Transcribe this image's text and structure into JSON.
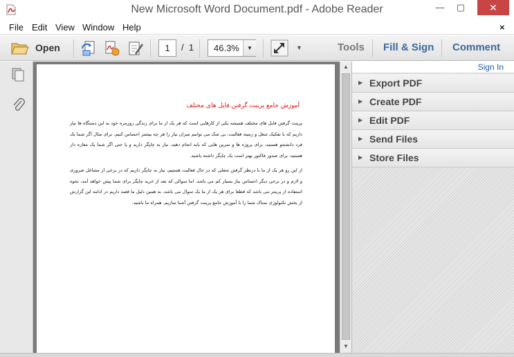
{
  "window": {
    "title": "New Microsoft Word Document.pdf - Adobe Reader",
    "minimize_glyph": "—",
    "maximize_glyph": "▢",
    "close_glyph": "✕"
  },
  "menu": {
    "items": [
      "File",
      "Edit",
      "View",
      "Window",
      "Help"
    ],
    "close_glyph": "×"
  },
  "toolbar": {
    "open_label": "Open",
    "page_current": "1",
    "page_separator": "/",
    "page_total": "1",
    "zoom": "46.3%",
    "tools_label": "Tools",
    "fill_sign_label": "Fill & Sign",
    "comment_label": "Comment"
  },
  "document": {
    "title": "آموزش جامع پرینت گرفتن فایل های مختلف",
    "paragraphs": [
      "پرینت گرفتن فایل های مختلف همیشه یکی از کارهایی است که هر یک از ما برای زندگی روزمره خود به این دستگاه ها نیاز داریم که با تفکیک شغل و زمینه فعالیت، بی شک می توانیم میزان نیاز را هر چه بیشتر احساس کنیم. برای مثال اگر شما یک فرد دانشجو هستید، برای پروژه ها و تمرین هایی که باید انجام دهید، نیاز به چاپگر دارید و یا حتی اگر شما یک مغازه دار هستید، برای صدور فاکتور بهتر است یک چاپگر داشته باشید.",
      "از این رو هر یک از ما با درنظر گرفتن شغلی که در حال فعالیت هستیم، نیاز به چاپگر داریم که در برخی از مشاغل ضروری و لازم و در برخی دیگر احساس نیاز بسیار کم می باشد. اما سوالی که بعد از خرید چاپگر برای شما پیش خواهد آمد، نحوه استفاده از پرینتر می باشد که قطعا برای هر یک از ما یک سوال می باشد. به همین دلیل ما قصد داریم در ادامه این گزارش از بخش تکنولوژی نمناک شما را با آموزش جامع پرینت گرفتن آشنا سازیم. همراه ما باشید."
    ]
  },
  "right_pane": {
    "sign_in": "Sign In",
    "items": [
      "Export PDF",
      "Create PDF",
      "Edit PDF",
      "Send Files",
      "Store Files"
    ]
  },
  "icons": {
    "app": "adobe-reader-icon",
    "open": "folder-icon",
    "create": "create-pdf-icon",
    "convert": "convert-pdf-icon",
    "sign": "sign-icon",
    "fit": "fit-page-icon",
    "pages": "pages-panel-icon",
    "attachments": "paperclip-icon"
  },
  "colors": {
    "accent": "#3a6a98",
    "doc_title": "#dd1111",
    "close_button": "#c74545",
    "link": "#1f5ea8"
  }
}
